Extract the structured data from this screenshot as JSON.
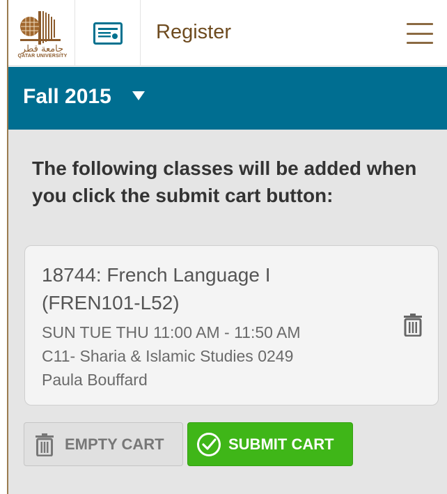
{
  "logo": {
    "arabic_text": "جامعة قطر",
    "english_text": "QATAR UNIVERSITY"
  },
  "header": {
    "title": "Register",
    "card_icon": "id-card-icon",
    "menu_icon": "hamburger-menu-icon"
  },
  "term": {
    "label": "Fall 2015",
    "dropdown_icon": "caret-down-icon"
  },
  "cart": {
    "intro": "The following classes will be added when you click the submit cart button:",
    "items": [
      {
        "title": "18744: French Language I (FREN101-L52)",
        "schedule": "SUN TUE THU 11:00 AM - 11:50 AM",
        "location": "C11- Sharia & Islamic Studies 0249",
        "instructor": "Paula Bouffard",
        "remove_icon": "trash-icon"
      }
    ],
    "empty_label": "EMPTY CART",
    "submit_label": "SUBMIT CART"
  },
  "colors": {
    "brand_brown": "#8b5a2b",
    "term_bar": "#006e91",
    "submit_green": "#3fb618"
  }
}
